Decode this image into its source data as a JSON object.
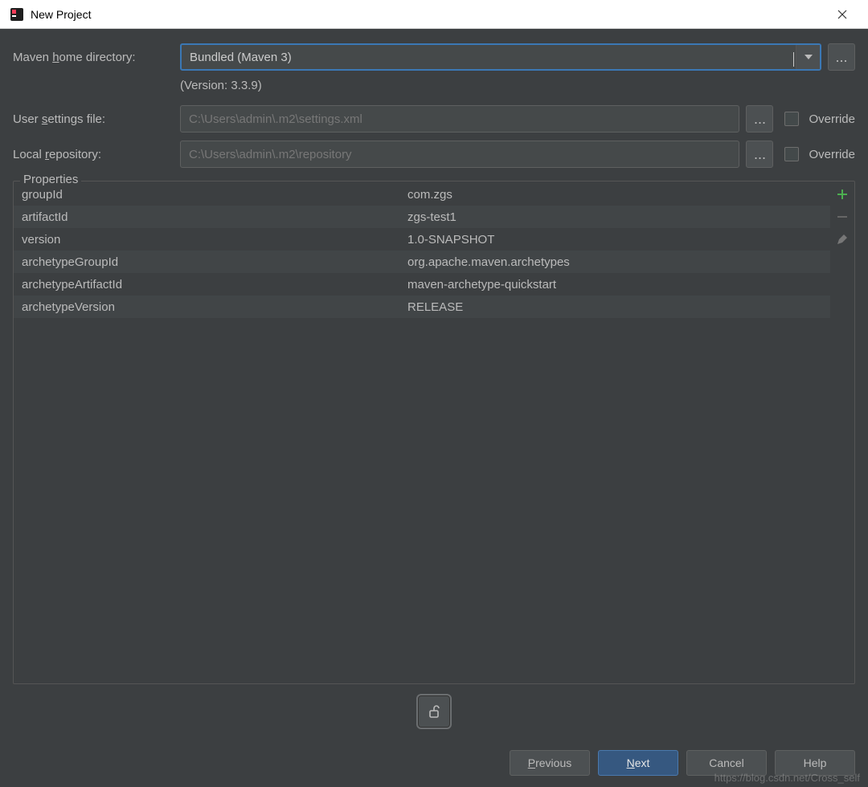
{
  "window": {
    "title": "New Project"
  },
  "labels": {
    "mavenHome_pre": "Maven ",
    "mavenHome_u": "h",
    "mavenHome_post": "ome directory:",
    "userSettings_pre": "User ",
    "userSettings_u": "s",
    "userSettings_post": "ettings file:",
    "localRepo_pre": "Local ",
    "localRepo_u": "r",
    "localRepo_post": "epository:",
    "override": "Override",
    "properties": "Properties"
  },
  "mavenHome": {
    "value": "Bundled (Maven 3)",
    "version": "(Version: 3.3.9)"
  },
  "userSettings": {
    "value": "C:\\Users\\admin\\.m2\\settings.xml"
  },
  "localRepo": {
    "value": "C:\\Users\\admin\\.m2\\repository"
  },
  "properties": [
    {
      "key": "groupId",
      "value": "com.zgs"
    },
    {
      "key": "artifactId",
      "value": "zgs-test1"
    },
    {
      "key": "version",
      "value": "1.0-SNAPSHOT"
    },
    {
      "key": "archetypeGroupId",
      "value": "org.apache.maven.archetypes"
    },
    {
      "key": "archetypeArtifactId",
      "value": "maven-archetype-quickstart"
    },
    {
      "key": "archetypeVersion",
      "value": "RELEASE"
    }
  ],
  "buttons": {
    "previous_u": "P",
    "previous_post": "revious",
    "next_u": "N",
    "next_post": "ext",
    "cancel": "Cancel",
    "help": "Help",
    "ellipsis": "..."
  },
  "watermark": "https://blog.csdn.net/Cross_self"
}
